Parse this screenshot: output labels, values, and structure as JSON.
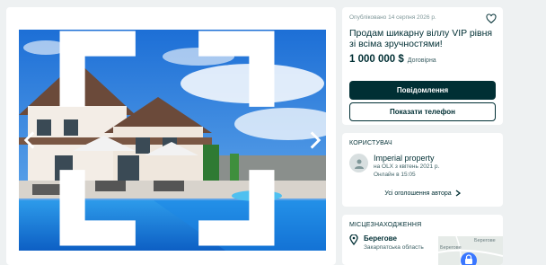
{
  "listing": {
    "date": "Опубліковано 14 серпня 2026 р.",
    "title": "Продам шикарну віллу VIP рівня зі всіма зручностями!",
    "price": "1 000 000 $",
    "negotiable": "Договірна",
    "message_button": "Повідомлення",
    "phone_button": "Показати телефон"
  },
  "seller": {
    "section_label": "КОРИСТУВАЧ",
    "name": "Imperial property",
    "since": "на OLX з квітень 2021 р.",
    "online": "Онлайн в 15:05",
    "all_ads": "Усі оголошення автора"
  },
  "location": {
    "section_label": "МІСЦЕЗНАХОДЖЕННЯ",
    "city": "Берегове",
    "region": "Закарпатська область",
    "map_labels": [
      "Берегове",
      "Берегове"
    ]
  },
  "icons": {
    "favorite": "heart-outline-icon",
    "prev": "chevron-left-icon",
    "next": "chevron-right-icon",
    "expand": "expand-icon",
    "location": "pin-icon"
  },
  "colors": {
    "primary": "#002f34",
    "background": "#eef1f2"
  }
}
